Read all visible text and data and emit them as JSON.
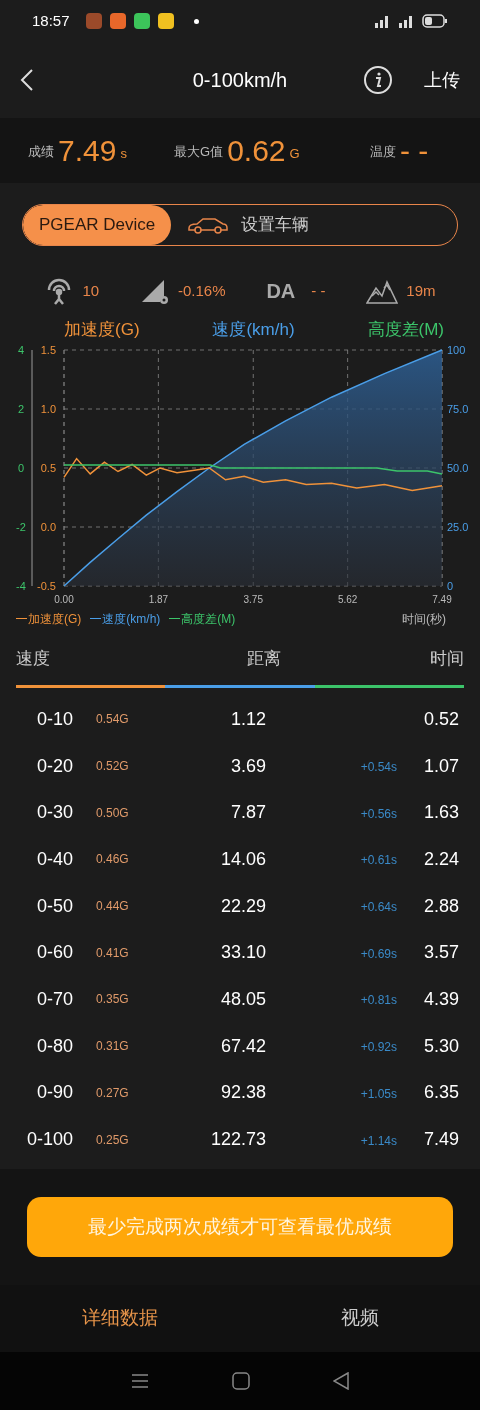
{
  "status_bar": {
    "time": "18:57"
  },
  "nav": {
    "title": "0-100km/h",
    "upload": "上传"
  },
  "stats": [
    {
      "label": "成绩",
      "value": "7.49",
      "unit": "s"
    },
    {
      "label": "最大G值",
      "value": "0.62",
      "unit": "G"
    },
    {
      "label": "温度",
      "value": "- -"
    }
  ],
  "segments": [
    {
      "label": "PGEAR Device",
      "selected": true
    },
    {
      "label": "设置车辆",
      "selected": false
    }
  ],
  "sensors": [
    {
      "kind": "satellite",
      "value": "10"
    },
    {
      "kind": "slope",
      "value": "-0.16%"
    },
    {
      "kind": "da",
      "label": "DA",
      "value": "- -"
    },
    {
      "kind": "altitude",
      "value": "19m"
    }
  ],
  "chart": {
    "titles": [
      {
        "text": "加速度(G)",
        "color": "#f0923a"
      },
      {
        "text": "速度(km/h)",
        "color": "#4a9ee8"
      },
      {
        "text": "高度差(M)",
        "color": "#3cc46a"
      }
    ],
    "time_label": "时间(秒)",
    "layers": [
      {
        "kind": "right",
        "chart_data": {
          "type": "area",
          "grid": true,
          "x": [
            0,
            0.52,
            1.07,
            1.63,
            2.24,
            2.88,
            3.57,
            4.39,
            5.3,
            6.35,
            7.49
          ],
          "xlim": [
            0,
            7.49
          ],
          "ylim": [
            0,
            100
          ],
          "xticks": [
            {
              "value": 0,
              "label": "0.00"
            },
            {
              "value": 1.87,
              "label": "1.87"
            },
            {
              "value": 3.75,
              "label": "3.75"
            },
            {
              "value": 5.62,
              "label": "5.62"
            },
            {
              "value": 7.49,
              "label": "7.49"
            }
          ],
          "yticks": [
            {
              "value": 100,
              "label": "100"
            },
            {
              "value": 75,
              "label": "75.0"
            },
            {
              "value": 50,
              "label": "50.0"
            },
            {
              "value": 25,
              "label": "25.0"
            },
            {
              "value": 0,
              "label": "0"
            }
          ],
          "series": [
            {
              "name": "速度(km/h)",
              "color": "#4a9ee8",
              "values": [
                0,
                10,
                20,
                30,
                40,
                50,
                60,
                70,
                80,
                90,
                100
              ]
            }
          ]
        }
      },
      {
        "kind": "inner-left",
        "chart_data": {
          "type": "line",
          "x": [
            0,
            0.25,
            0.52,
            0.8,
            1.07,
            1.35,
            1.63,
            1.9,
            2.24,
            2.55,
            2.88,
            3.2,
            3.57,
            3.95,
            4.39,
            4.8,
            5.3,
            5.8,
            6.35,
            6.9,
            7.49
          ],
          "xlim": [
            0,
            7.49
          ],
          "ylim": [
            -0.5,
            1.5
          ],
          "yticks": [
            {
              "value": 1.5,
              "label": "1.5"
            },
            {
              "value": 1.0,
              "label": "1.0"
            },
            {
              "value": 0.5,
              "label": "0.5"
            },
            {
              "value": 0.0,
              "label": "0.0"
            },
            {
              "value": -0.5,
              "label": "-0.5"
            }
          ],
          "series": [
            {
              "name": "加速度(G)",
              "color": "#f0923a",
              "values": [
                0.42,
                0.58,
                0.45,
                0.55,
                0.47,
                0.53,
                0.44,
                0.5,
                0.46,
                0.48,
                0.5,
                0.4,
                0.43,
                0.38,
                0.4,
                0.36,
                0.37,
                0.33,
                0.36,
                0.31,
                0.35
              ]
            }
          ]
        }
      },
      {
        "kind": "outer-left",
        "chart_data": {
          "type": "line",
          "x": [
            0,
            1,
            2,
            2.9,
            3.1,
            4,
            5,
            6.2,
            6.6,
            7.2,
            7.49
          ],
          "xlim": [
            0,
            7.49
          ],
          "ylim": [
            -4,
            4
          ],
          "yticks": [
            {
              "value": 4,
              "label": "4"
            },
            {
              "value": 2,
              "label": "2"
            },
            {
              "value": 0,
              "label": "0"
            },
            {
              "value": -2,
              "label": "-2"
            },
            {
              "value": -4,
              "label": "-4"
            }
          ],
          "series": [
            {
              "name": "高度差(M)",
              "color": "#3cc46a",
              "values": [
                0.1,
                0.1,
                0.1,
                0.1,
                0,
                0,
                0,
                0,
                -0.1,
                -0.1,
                -0.2
              ]
            }
          ]
        }
      }
    ]
  },
  "table": {
    "columns": [
      "速度",
      "距离",
      "时间"
    ],
    "rows": [
      {
        "range": "0-10",
        "g": "0.54G",
        "distance": "1.12",
        "time": "0.52"
      },
      {
        "range": "0-20",
        "g": "0.52G",
        "distance": "3.69",
        "delta": "+0.54s",
        "time": "1.07"
      },
      {
        "range": "0-30",
        "g": "0.50G",
        "distance": "7.87",
        "delta": "+0.56s",
        "time": "1.63"
      },
      {
        "range": "0-40",
        "g": "0.46G",
        "distance": "14.06",
        "delta": "+0.61s",
        "time": "2.24"
      },
      {
        "range": "0-50",
        "g": "0.44G",
        "distance": "22.29",
        "delta": "+0.64s",
        "time": "2.88"
      },
      {
        "range": "0-60",
        "g": "0.41G",
        "distance": "33.10",
        "delta": "+0.69s",
        "time": "3.57"
      },
      {
        "range": "0-70",
        "g": "0.35G",
        "distance": "48.05",
        "delta": "+0.81s",
        "time": "4.39"
      },
      {
        "range": "0-80",
        "g": "0.31G",
        "distance": "67.42",
        "delta": "+0.92s",
        "time": "5.30"
      },
      {
        "range": "0-90",
        "g": "0.27G",
        "distance": "92.38",
        "delta": "+1.05s",
        "time": "6.35"
      },
      {
        "range": "0-100",
        "g": "0.25G",
        "distance": "122.73",
        "delta": "+1.14s",
        "time": "7.49"
      }
    ]
  },
  "best_button": "最少完成两次成绩才可查看最优成绩",
  "bottom_tabs": [
    {
      "label": "详细数据",
      "selected": true
    },
    {
      "label": "视频",
      "selected": false
    }
  ]
}
